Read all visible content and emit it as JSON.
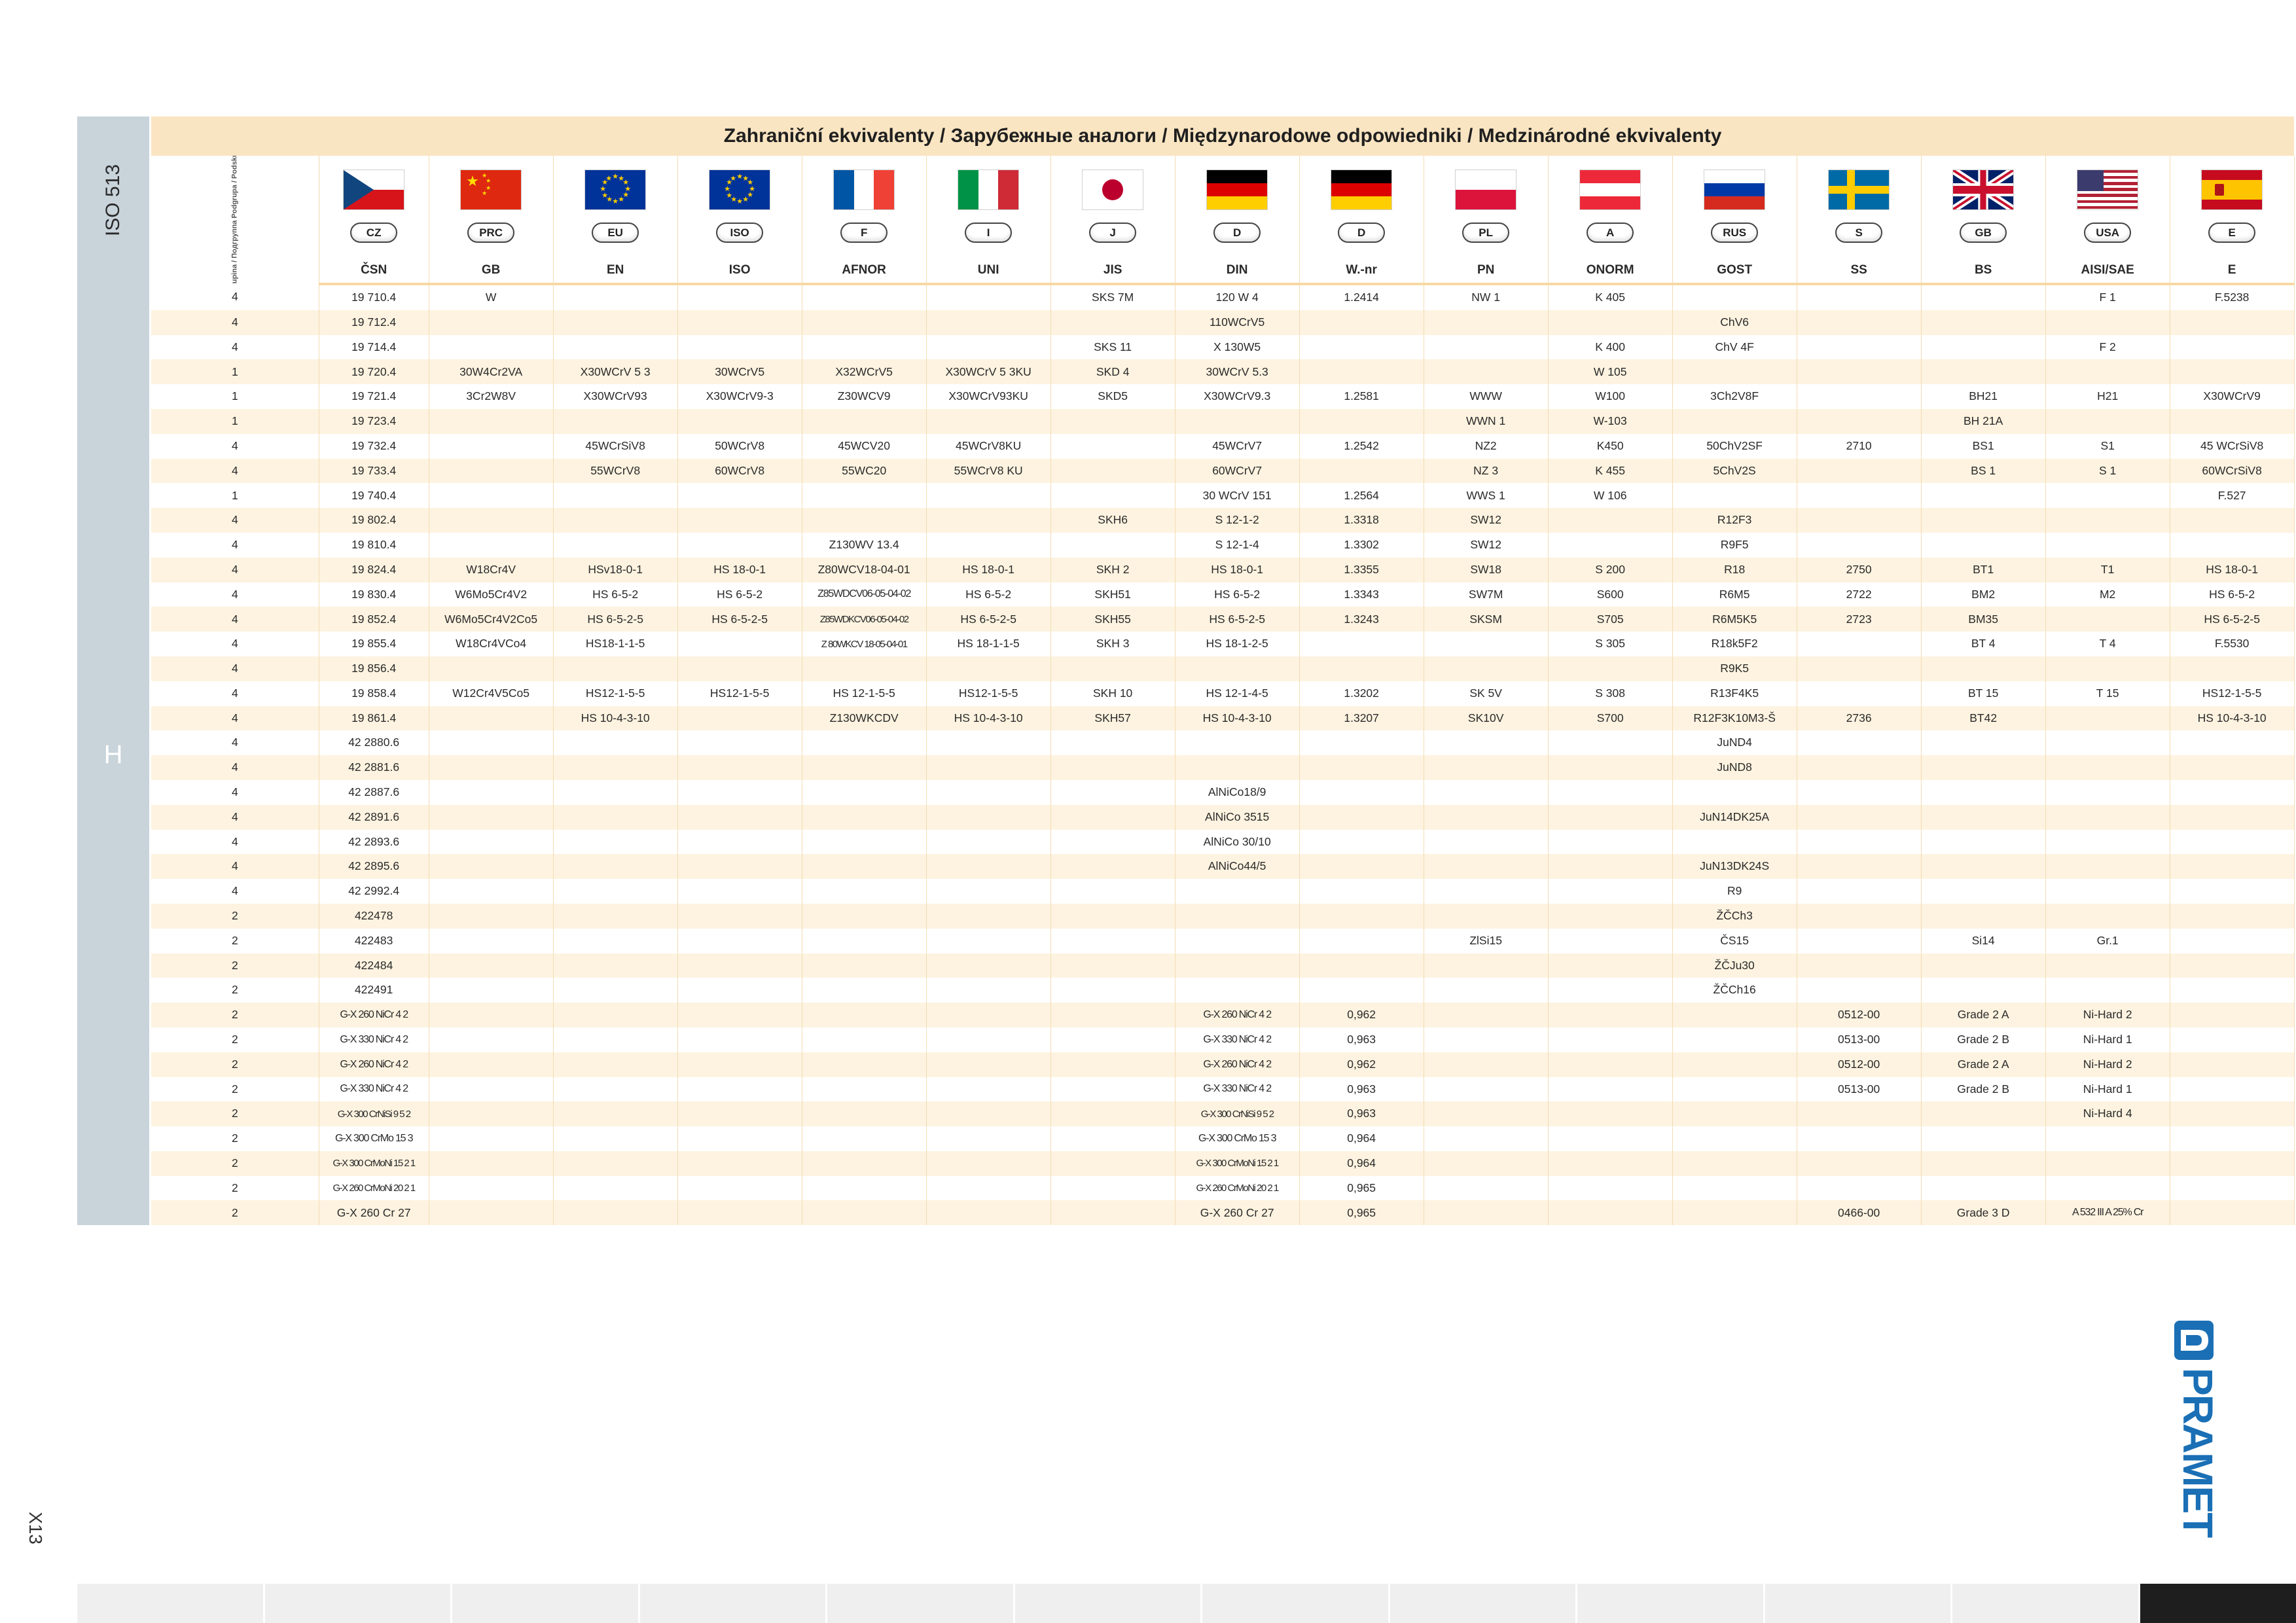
{
  "header": {
    "iso_label": "ISO 513",
    "title": "Zahraniční ekvivalenty / Зарубежные аналоги / Międzynarodowe odpowiedniki / Medzinárodné ekvivalenty",
    "subgroup_label": "Podskupina / Подгруппа Podgrupa / Podskupina",
    "group_letter": "H"
  },
  "flags": [
    {
      "name": "cz",
      "code": "CZ",
      "standard": "ČSN"
    },
    {
      "name": "prc",
      "code": "PRC",
      "standard": "GB"
    },
    {
      "name": "eu",
      "code": "EU",
      "standard": "EN"
    },
    {
      "name": "eu",
      "code": "ISO",
      "standard": "ISO"
    },
    {
      "name": "fr",
      "code": "F",
      "standard": "AFNOR"
    },
    {
      "name": "it",
      "code": "I",
      "standard": "UNI"
    },
    {
      "name": "jp",
      "code": "J",
      "standard": "JIS"
    },
    {
      "name": "de",
      "code": "D",
      "standard": "DIN"
    },
    {
      "name": "de",
      "code": "D",
      "standard": "W.-nr"
    },
    {
      "name": "pl",
      "code": "PL",
      "standard": "PN"
    },
    {
      "name": "at",
      "code": "A",
      "standard": "ONORM"
    },
    {
      "name": "ru",
      "code": "RUS",
      "standard": "GOST"
    },
    {
      "name": "se",
      "code": "S",
      "standard": "SS"
    },
    {
      "name": "gb",
      "code": "GB",
      "standard": "BS"
    },
    {
      "name": "us",
      "code": "USA",
      "standard": "AISI/SAE"
    },
    {
      "name": "es",
      "code": "E",
      "standard": "E"
    }
  ],
  "rows": [
    [
      "4",
      "19 710.4",
      "W",
      "",
      "",
      "",
      "",
      "SKS 7M",
      "120 W 4",
      "1.2414",
      "NW 1",
      "K 405",
      "",
      "",
      "",
      "F 1",
      "F.5238"
    ],
    [
      "4",
      "19 712.4",
      "",
      "",
      "",
      "",
      "",
      "",
      "110WCrV5",
      "",
      "",
      "",
      "ChV6",
      "",
      "",
      "",
      ""
    ],
    [
      "4",
      "19 714.4",
      "",
      "",
      "",
      "",
      "",
      "SKS 11",
      "X 130W5",
      "",
      "",
      "K 400",
      "ChV 4F",
      "",
      "",
      "F 2",
      ""
    ],
    [
      "1",
      "19 720.4",
      "30W4Cr2VA",
      "X30WCrV 5 3",
      "30WCrV5",
      "X32WCrV5",
      "X30WCrV 5 3KU",
      "SKD 4",
      "30WCrV 5.3",
      "",
      "",
      "W 105",
      "",
      "",
      "",
      "",
      ""
    ],
    [
      "1",
      "19 721.4",
      "3Cr2W8V",
      "X30WCrV93",
      "X30WCrV9-3",
      "Z30WCV9",
      "X30WCrV93KU",
      "SKD5",
      "X30WCrV9.3",
      "1.2581",
      "WWW",
      "W100",
      "3Ch2V8F",
      "",
      "BH21",
      "H21",
      "X30WCrV9"
    ],
    [
      "1",
      "19 723.4",
      "",
      "",
      "",
      "",
      "",
      "",
      "",
      "",
      "WWN 1",
      "W-103",
      "",
      "",
      "BH 21A",
      "",
      ""
    ],
    [
      "4",
      "19 732.4",
      "",
      "45WCrSiV8",
      "50WCrV8",
      "45WCV20",
      "45WCrV8KU",
      "",
      "45WCrV7",
      "1.2542",
      "NZ2",
      "K450",
      "50ChV2SF",
      "2710",
      "BS1",
      "S1",
      "45 WCrSiV8"
    ],
    [
      "4",
      "19 733.4",
      "",
      "55WCrV8",
      "60WCrV8",
      "55WC20",
      "55WCrV8 KU",
      "",
      "60WCrV7",
      "",
      "NZ 3",
      "K 455",
      "5ChV2S",
      "",
      "BS 1",
      "S 1",
      "60WCrSiV8"
    ],
    [
      "1",
      "19 740.4",
      "",
      "",
      "",
      "",
      "",
      "",
      "30 WCrV 151",
      "1.2564",
      "WWS 1",
      "W 106",
      "",
      "",
      "",
      "",
      "F.527"
    ],
    [
      "4",
      "19 802.4",
      "",
      "",
      "",
      "",
      "",
      "SKH6",
      "S 12-1-2",
      "1.3318",
      "SW12",
      "",
      "R12F3",
      "",
      "",
      "",
      ""
    ],
    [
      "4",
      "19 810.4",
      "",
      "",
      "",
      "Z130WV 13.4",
      "",
      "",
      "S 12-1-4",
      "1.3302",
      "SW12",
      "",
      "R9F5",
      "",
      "",
      "",
      ""
    ],
    [
      "4",
      "19 824.4",
      "W18Cr4V",
      "HSv18-0-1",
      "HS 18-0-1",
      "Z80WCV18-04-01",
      "HS 18-0-1",
      "SKH 2",
      "HS 18-0-1",
      "1.3355",
      "SW18",
      "S 200",
      "R18",
      "2750",
      "BT1",
      "T1",
      "HS 18-0-1"
    ],
    [
      "4",
      "19 830.4",
      "W6Mo5Cr4V2",
      "HS 6-5-2",
      "HS 6-5-2",
      "Z85WDCV06-05-04-02",
      "HS 6-5-2",
      "SKH51",
      "HS 6-5-2",
      "1.3343",
      "SW7M",
      "S600",
      "R6M5",
      "2722",
      "BM2",
      "M2",
      "HS 6-5-2"
    ],
    [
      "4",
      "19 852.4",
      "W6Mo5Cr4V2Co5",
      "HS 6-5-2-5",
      "HS 6-5-2-5",
      "Z85WDKCV06-05-04-02",
      "HS 6-5-2-5",
      "SKH55",
      "HS 6-5-2-5",
      "1.3243",
      "SKSM",
      "S705",
      "R6M5K5",
      "2723",
      "BM35",
      "",
      "HS 6-5-2-5"
    ],
    [
      "4",
      "19 855.4",
      "W18Cr4VCo4",
      "HS18-1-1-5",
      "",
      "Z 80WKCV 18-05-04-01",
      "HS 18-1-1-5",
      "SKH 3",
      "HS 18-1-2-5",
      "",
      "",
      "S 305",
      "R18k5F2",
      "",
      "BT 4",
      "T 4",
      "F.5530"
    ],
    [
      "4",
      "19 856.4",
      "",
      "",
      "",
      "",
      "",
      "",
      "",
      "",
      "",
      "",
      "R9K5",
      "",
      "",
      "",
      ""
    ],
    [
      "4",
      "19 858.4",
      "W12Cr4V5Co5",
      "HS12-1-5-5",
      "HS12-1-5-5",
      "HS 12-1-5-5",
      "HS12-1-5-5",
      "SKH 10",
      "HS 12-1-4-5",
      "1.3202",
      "SK 5V",
      "S 308",
      "R13F4K5",
      "",
      "BT 15",
      "T 15",
      "HS12-1-5-5"
    ],
    [
      "4",
      "19 861.4",
      "",
      "HS 10-4-3-10",
      "",
      "Z130WKCDV",
      "HS 10-4-3-10",
      "SKH57",
      "HS 10-4-3-10",
      "1.3207",
      "SK10V",
      "S700",
      "R12F3K10M3-Š",
      "2736",
      "BT42",
      "",
      "HS 10-4-3-10"
    ],
    [
      "4",
      "42 2880.6",
      "",
      "",
      "",
      "",
      "",
      "",
      "",
      "",
      "",
      "",
      "JuND4",
      "",
      "",
      "",
      ""
    ],
    [
      "4",
      "42 2881.6",
      "",
      "",
      "",
      "",
      "",
      "",
      "",
      "",
      "",
      "",
      "JuND8",
      "",
      "",
      "",
      ""
    ],
    [
      "4",
      "42 2887.6",
      "",
      "",
      "",
      "",
      "",
      "",
      "AlNiCo18/9",
      "",
      "",
      "",
      "",
      "",
      "",
      "",
      ""
    ],
    [
      "4",
      "42 2891.6",
      "",
      "",
      "",
      "",
      "",
      "",
      "AlNiCo 3515",
      "",
      "",
      "",
      "JuN14DK25A",
      "",
      "",
      "",
      ""
    ],
    [
      "4",
      "42 2893.6",
      "",
      "",
      "",
      "",
      "",
      "",
      "AlNiCo 30/10",
      "",
      "",
      "",
      "",
      "",
      "",
      "",
      ""
    ],
    [
      "4",
      "42 2895.6",
      "",
      "",
      "",
      "",
      "",
      "",
      "AlNiCo44/5",
      "",
      "",
      "",
      "JuN13DK24S",
      "",
      "",
      "",
      ""
    ],
    [
      "4",
      "42 2992.4",
      "",
      "",
      "",
      "",
      "",
      "",
      "",
      "",
      "",
      "",
      "R9",
      "",
      "",
      "",
      ""
    ],
    [
      "2",
      "422478",
      "",
      "",
      "",
      "",
      "",
      "",
      "",
      "",
      "",
      "",
      "ŽČCh3",
      "",
      "",
      "",
      ""
    ],
    [
      "2",
      "422483",
      "",
      "",
      "",
      "",
      "",
      "",
      "",
      "",
      "ZlSi15",
      "",
      "ČS15",
      "",
      "Si14",
      "Gr.1",
      ""
    ],
    [
      "2",
      "422484",
      "",
      "",
      "",
      "",
      "",
      "",
      "",
      "",
      "",
      "",
      "ŽČJu30",
      "",
      "",
      "",
      ""
    ],
    [
      "2",
      "422491",
      "",
      "",
      "",
      "",
      "",
      "",
      "",
      "",
      "",
      "",
      "ŽČCh16",
      "",
      "",
      "",
      ""
    ],
    [
      "2",
      "G-X 260 NiCr 4 2",
      "",
      "",
      "",
      "",
      "",
      "",
      "G-X 260 NiCr 4 2",
      "0,962",
      "",
      "",
      "",
      "0512-00",
      "Grade 2 A",
      "Ni-Hard 2",
      ""
    ],
    [
      "2",
      "G-X 330 NiCr 4 2",
      "",
      "",
      "",
      "",
      "",
      "",
      "G-X 330 NiCr 4 2",
      "0,963",
      "",
      "",
      "",
      "0513-00",
      "Grade 2 B",
      "Ni-Hard 1",
      ""
    ],
    [
      "2",
      "G-X 260 NiCr 4 2",
      "",
      "",
      "",
      "",
      "",
      "",
      "G-X 260 NiCr 4 2",
      "0,962",
      "",
      "",
      "",
      "0512-00",
      "Grade 2 A",
      "Ni-Hard 2",
      ""
    ],
    [
      "2",
      "G-X 330 NiCr 4 2",
      "",
      "",
      "",
      "",
      "",
      "",
      "G-X 330 NiCr 4 2",
      "0,963",
      "",
      "",
      "",
      "0513-00",
      "Grade 2 B",
      "Ni-Hard 1",
      ""
    ],
    [
      "2",
      "G-X 300 CrNiSi 9 5 2",
      "",
      "",
      "",
      "",
      "",
      "",
      "G-X 300 CrNiSi 9 5 2",
      "0,963",
      "",
      "",
      "",
      "",
      "",
      "Ni-Hard 4",
      ""
    ],
    [
      "2",
      "G-X 300 CrMo 15 3",
      "",
      "",
      "",
      "",
      "",
      "",
      "G-X 300 CrMo 15 3",
      "0,964",
      "",
      "",
      "",
      "",
      "",
      "",
      ""
    ],
    [
      "2",
      "G-X 300 CrMoNi 15 2 1",
      "",
      "",
      "",
      "",
      "",
      "",
      "G-X 300 CrMoNi 15 2 1",
      "0,964",
      "",
      "",
      "",
      "",
      "",
      "",
      ""
    ],
    [
      "2",
      "G-X 260 CrMoNi 20 2 1",
      "",
      "",
      "",
      "",
      "",
      "",
      "G-X 260 CrMoNi 20 2 1",
      "0,965",
      "",
      "",
      "",
      "",
      "",
      "",
      ""
    ],
    [
      "2",
      "G-X 260 Cr 27",
      "",
      "",
      "",
      "",
      "",
      "",
      "G-X 260 Cr 27",
      "0,965",
      "",
      "",
      "",
      "0466-00",
      "Grade 3 D",
      "A 532 III A 25% Cr",
      ""
    ]
  ],
  "footer": {
    "page_number": "X13",
    "logo_text": "PRAMET"
  },
  "colors": {
    "header_bg": "#fae5c2",
    "row_alt_bg": "#fdf3e0",
    "iso_band": "#c8d3da",
    "logo_blue": "#1a6fb5",
    "footer_dark": "#1e1e1e"
  }
}
